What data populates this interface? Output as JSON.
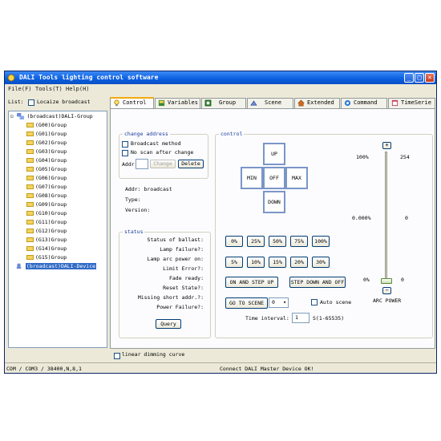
{
  "window": {
    "title": "DALI Tools lighting control software"
  },
  "menu": [
    "File(F)",
    "Tools(T)",
    "Help(H)"
  ],
  "list": {
    "label": "List:",
    "locate_label": "Locaize broadcast",
    "locate_checked": false
  },
  "tree": {
    "root": "(broadcast)DALI-Group",
    "groups": [
      "(G00)Group",
      "(G01)Group",
      "(G02)Group",
      "(G03)Group",
      "(G04)Group",
      "(G05)Group",
      "(G06)Group",
      "(G07)Group",
      "(G08)Group",
      "(G09)Group",
      "(G10)Group",
      "(G11)Group",
      "(G12)Group",
      "(G13)Group",
      "(G14)Group",
      "(G15)Group"
    ],
    "device": "(broadcast)DALI-Device"
  },
  "tabs": [
    {
      "label": "Control",
      "icon": "bulb-icon",
      "active": true
    },
    {
      "label": "Variables",
      "icon": "variables-icon",
      "active": false
    },
    {
      "label": "Group",
      "icon": "group-icon",
      "active": false
    },
    {
      "label": "Scene",
      "icon": "scene-icon",
      "active": false
    },
    {
      "label": "Extended",
      "icon": "house-icon",
      "active": false
    },
    {
      "label": "Command",
      "icon": "command-icon",
      "active": false
    },
    {
      "label": "TimeSerie",
      "icon": "timeserie-icon",
      "active": false
    }
  ],
  "change_address": {
    "legend": "change address",
    "broadcast_method": "Broadcast method",
    "no_scan": "No scan after change",
    "addr_label": "Addr",
    "addr_value": "",
    "change_btn": "Change",
    "delete_btn": "Delete"
  },
  "info": {
    "addr": "Addr: broadcast",
    "type": "Type:",
    "version": "Version:"
  },
  "status": {
    "legend": "status",
    "rows": [
      "Status of ballast:",
      "Lamp failure?:",
      "Lamp arc power on:",
      "Limit Error?:",
      "Fade ready:",
      "Reset State?:",
      "Missing short addr.?:",
      "Power Failure?:"
    ],
    "query_btn": "Query"
  },
  "control": {
    "legend": "control",
    "up": "UP",
    "min": "MIN",
    "off": "OFF",
    "max": "MAX",
    "down": "DOWN",
    "pct_row1": [
      "0%",
      "25%",
      "50%",
      "75%",
      "100%"
    ],
    "pct_row2": [
      "5%",
      "10%",
      "15%",
      "20%",
      "30%"
    ],
    "on_step_up": "ON AND STEP UP",
    "step_down_off": "STEP DOWN AND OFF",
    "goto_scene": "GO TO SCENE",
    "scene_value": "0",
    "auto_scene": "Auto scene",
    "time_interval_label": "Time interval:",
    "time_interval_value": "1",
    "time_unit": "S(1-65535)",
    "slider_top_pct": "100%",
    "slider_top_val": "254",
    "slider_mid_pct": "0.000%",
    "slider_mid_val": "0",
    "slider_bot_pct": "0%",
    "slider_bot_val": "0",
    "slider_level": 0,
    "plus": "+",
    "minus": "−",
    "arc_power": "ARC POWER"
  },
  "linear_dimming": "linear dimming curve",
  "statusbar": {
    "port": "COM / COM3 / 38400,N,8,1",
    "message": "Connect DALI Master Device OK!"
  }
}
